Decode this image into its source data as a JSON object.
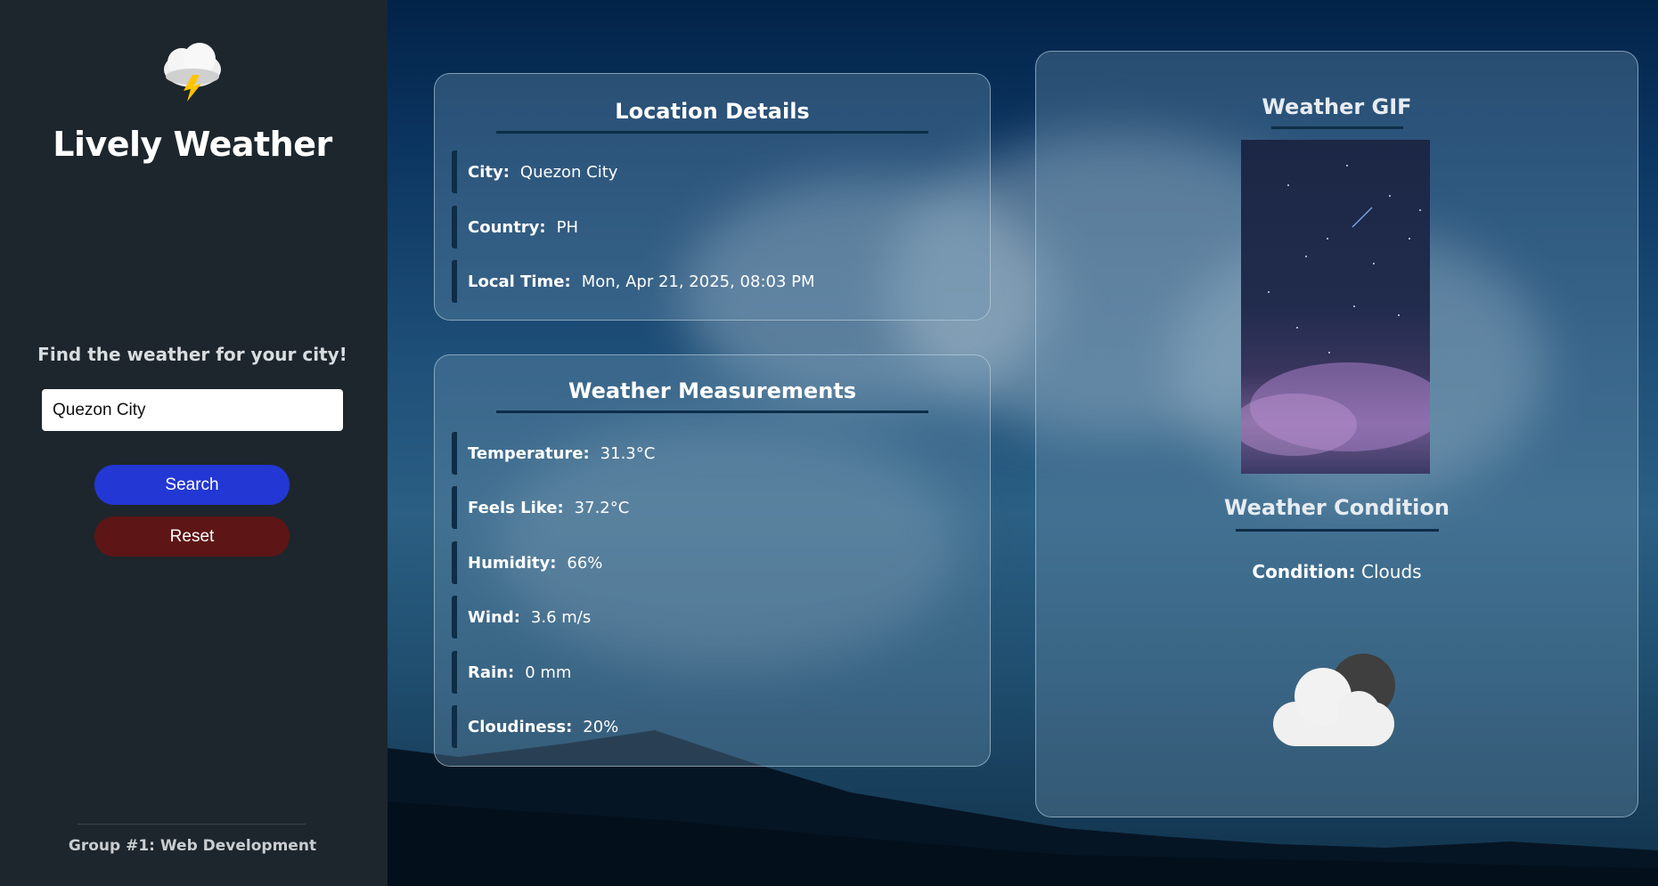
{
  "sidebar": {
    "logo_icon": "thunderstorm-cloud-icon",
    "app_title": "Lively Weather",
    "prompt": "Find the weather for your city!",
    "search_value": "Quezon City",
    "search_button": "Search",
    "reset_button": "Reset",
    "footer": "Group #1: Web Development"
  },
  "location": {
    "title": "Location Details",
    "rows": [
      {
        "label": "City:",
        "value": "Quezon City"
      },
      {
        "label": "Country:",
        "value": "PH"
      },
      {
        "label": "Local Time:",
        "value": "Mon, Apr 21, 2025, 08:03 PM"
      }
    ]
  },
  "measurements": {
    "title": "Weather Measurements",
    "rows": [
      {
        "label": "Temperature:",
        "value": "31.3°C"
      },
      {
        "label": "Feels Like:",
        "value": "37.2°C"
      },
      {
        "label": "Humidity:",
        "value": "66%"
      },
      {
        "label": "Wind:",
        "value": "3.6 m/s"
      },
      {
        "label": "Rain:",
        "value": "0 mm"
      },
      {
        "label": "Cloudiness:",
        "value": "20%"
      }
    ]
  },
  "weather_panel": {
    "gif_title": "Weather GIF",
    "condition_title": "Weather Condition",
    "condition_label": "Condition:",
    "condition_value": "Clouds",
    "condition_icon": "cloudy-night-icon"
  },
  "colors": {
    "sidebar_bg": "#1d262c",
    "search_button": "#2337d4",
    "reset_button": "#5e1515",
    "accent_rule": "#0e2d47"
  }
}
